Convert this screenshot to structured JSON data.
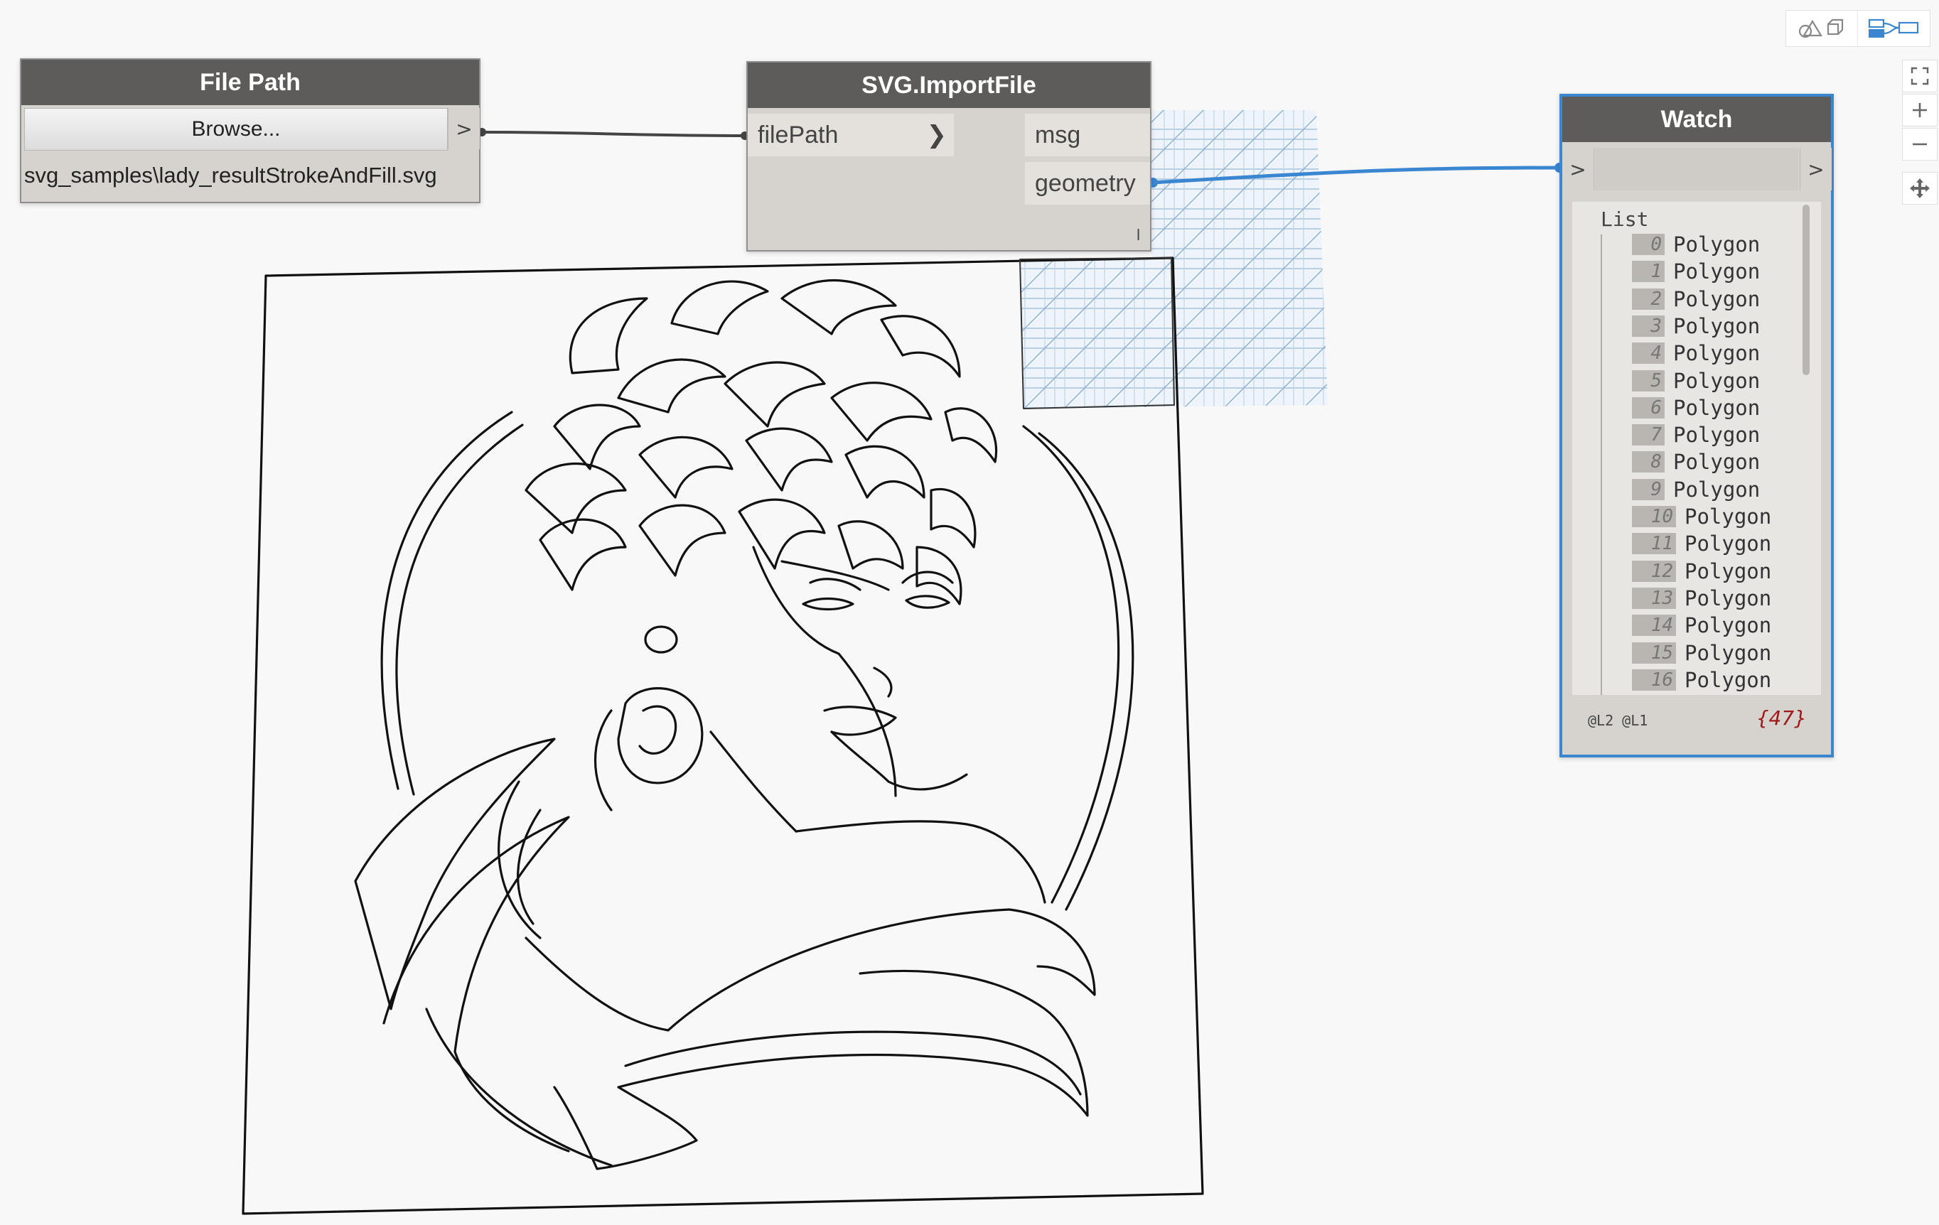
{
  "file_path_node": {
    "title": "File Path",
    "browse_label": "Browse...",
    "output_port": ">",
    "value": "svg_samples\\lady_resultStrokeAndFill.svg"
  },
  "import_node": {
    "title": "SVG.ImportFile",
    "input_port": "filePath",
    "outputs": [
      "msg",
      "geometry"
    ],
    "lacing_mark": "l"
  },
  "watch_node": {
    "title": "Watch",
    "input_port": ">",
    "output_port": ">",
    "list_header": "List",
    "items": [
      {
        "index": "0",
        "value": "Polygon"
      },
      {
        "index": "1",
        "value": "Polygon"
      },
      {
        "index": "2",
        "value": "Polygon"
      },
      {
        "index": "3",
        "value": "Polygon"
      },
      {
        "index": "4",
        "value": "Polygon"
      },
      {
        "index": "5",
        "value": "Polygon"
      },
      {
        "index": "6",
        "value": "Polygon"
      },
      {
        "index": "7",
        "value": "Polygon"
      },
      {
        "index": "8",
        "value": "Polygon"
      },
      {
        "index": "9",
        "value": "Polygon"
      },
      {
        "index": "10",
        "value": "Polygon"
      },
      {
        "index": "11",
        "value": "Polygon"
      },
      {
        "index": "12",
        "value": "Polygon"
      },
      {
        "index": "13",
        "value": "Polygon"
      },
      {
        "index": "14",
        "value": "Polygon"
      },
      {
        "index": "15",
        "value": "Polygon"
      },
      {
        "index": "16",
        "value": "Polygon"
      }
    ],
    "levels": "@L2 @L1",
    "count": "{47}"
  },
  "view_toggle": {
    "icons": [
      "geometry-view-icon",
      "graph-view-icon"
    ],
    "active": "graph-view-icon"
  },
  "navigation": {
    "icons": [
      "zoom-extents-icon",
      "zoom-in-icon",
      "zoom-out-icon",
      "pan-icon"
    ]
  },
  "colors": {
    "canvas": "#f8f8f8",
    "node_header": "#5e5c5a",
    "node_body": "#d6d3ce",
    "wire_default": "#444444",
    "wire_selected": "#3a86d1",
    "selection_border": "#3a86d1",
    "count_text": "#a01818"
  }
}
